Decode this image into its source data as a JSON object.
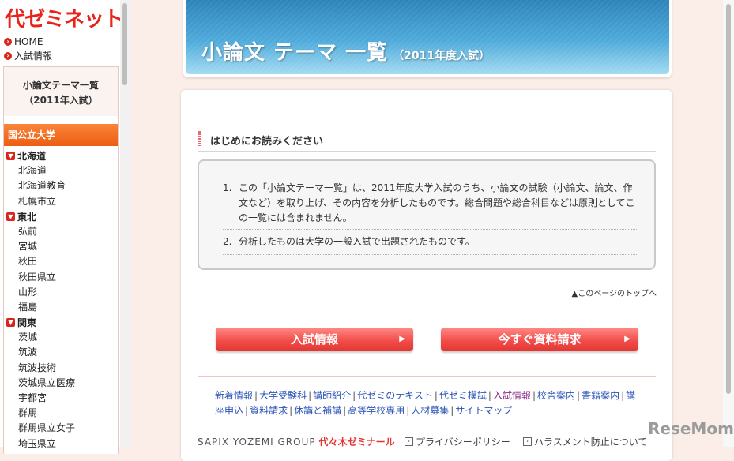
{
  "logo": "代ゼミネット",
  "top_links": [
    "HOME",
    "入試情報"
  ],
  "sidebar": {
    "title_line1": "小論文テーマ一覧",
    "title_line2": "（2011年入試）",
    "category": "国公立大学",
    "regions": [
      {
        "name": "北海道",
        "schools": [
          "北海道",
          "北海道教育",
          "札幌市立"
        ]
      },
      {
        "name": "東北",
        "schools": [
          "弘前",
          "宮城",
          "秋田",
          "秋田県立",
          "山形",
          "福島"
        ]
      },
      {
        "name": "関東",
        "schools": [
          "茨城",
          "筑波",
          "筑波技術",
          "茨城県立医療",
          "宇都宮",
          "群馬",
          "群馬県立女子",
          "埼玉県立"
        ]
      }
    ]
  },
  "banner": {
    "title": "小論文 テーマ 一覧",
    "subtitle": "（2011年度入試）"
  },
  "section": {
    "heading": "はじめにお読みください"
  },
  "notes": [
    {
      "num": "1.",
      "text": "この「小論文テーマ一覧」は、2011年度大学入試のうち、小論文の試験（小論文、論文、作文など）を取り上げ、その内容を分析したものです。総合問題や総合科目などは原則としてこの一覧には含まれません。"
    },
    {
      "num": "2.",
      "text": "分析したものは大学の一般入試で出題されたものです。"
    }
  ],
  "back_to_top": "▲このページのトップへ",
  "buttons": {
    "exam_info": "入試情報",
    "request": "今すぐ資料請求",
    "arrow": "▶"
  },
  "footer_links": [
    "新着情報",
    "大学受験科",
    "講師紹介",
    "代ゼミのテキスト",
    "代ゼミ模試",
    "入試情報",
    "校舎案内",
    "書籍案内",
    "講座申込",
    "資料請求",
    "休講と補講",
    "高等学校専用",
    "人材募集",
    "サイトマップ"
  ],
  "footer_separator": "|",
  "bottom": {
    "group": "SAPIX YOZEMI GROUP",
    "brand": "代々木ゼミナール",
    "privacy": "プライバシーポリシー",
    "harassment": "ハラスメント防止について"
  },
  "watermark": "ReseMom",
  "colors": {
    "logo_red": "#e8231a",
    "category_orange": "#f27a28",
    "banner_blue": "#3f9bd1",
    "cta_red": "#f24e4a",
    "link_blue": "#2a53b6",
    "link_visited": "#8b2a8b"
  }
}
